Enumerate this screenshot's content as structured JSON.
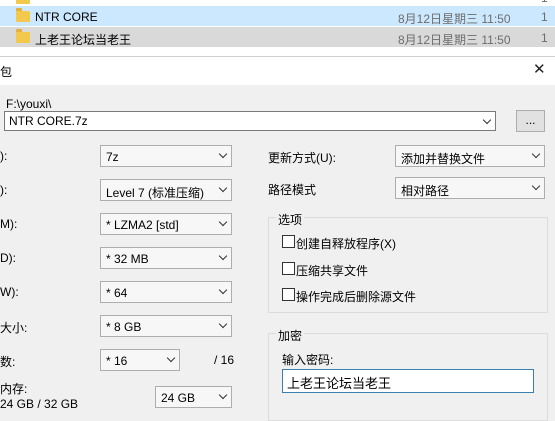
{
  "explorer": {
    "rows": [
      {
        "name": "NTR CORE",
        "date": "8月12日星期三 11:50"
      },
      {
        "name": "上老王论坛当老王",
        "date": "8月12日星期三 11:50"
      }
    ],
    "partial_char": "1"
  },
  "dialog": {
    "title_fragment": "包",
    "close_symbol": "✕",
    "path_label": "F:\\youxi\\",
    "archive_name": "NTR CORE.7z",
    "browse_label": "...",
    "left_labels": {
      "format": "):",
      "level": "):",
      "method": "M):",
      "dict": "D):",
      "word": "W):",
      "solid": "大小:",
      "threads": "数:",
      "memory": "内存:",
      "memory_usage": "24 GB / 32 GB"
    },
    "combos": {
      "format": "7z",
      "level": "Level 7 (标准压缩)",
      "method": "*  LZMA2 [std]",
      "dict": "*  32 MB",
      "word": "*  64",
      "solid": "*  8 GB",
      "threads": "*  16",
      "memory": "24 GB"
    },
    "threads_total": "/ 16",
    "update_mode_label": "更新方式(U):",
    "update_mode_value": "添加并替换文件",
    "path_mode_label": "路径模式",
    "path_mode_value": "相对路径",
    "options": {
      "title": "选项",
      "items": [
        "创建自释放程序(X)",
        "压缩共享文件",
        "操作完成后删除源文件"
      ]
    },
    "encryption": {
      "title": "加密",
      "password_label": "输入密码:",
      "password_value": "上老王论坛当老王"
    }
  }
}
